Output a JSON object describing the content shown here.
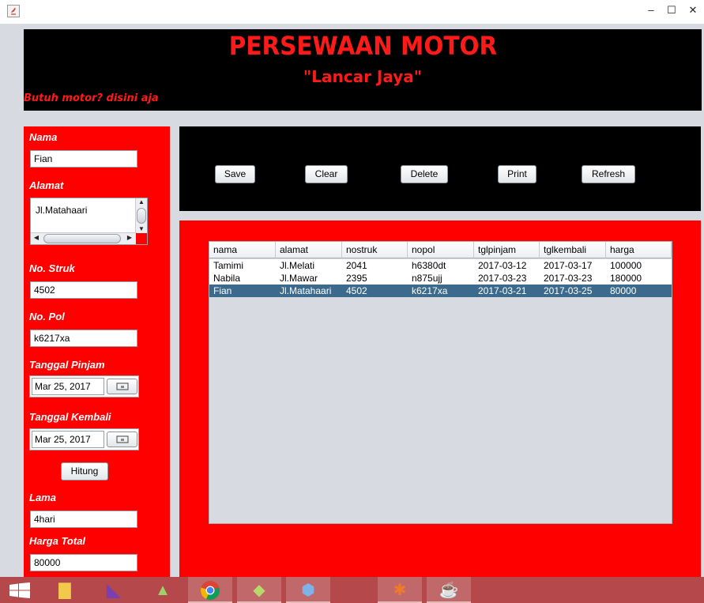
{
  "window": {
    "minimize": "–",
    "maximize": "☐",
    "close": "✕"
  },
  "banner": {
    "title": "PERSEWAAN MOTOR",
    "subtitle": "\"Lancar Jaya\"",
    "tagline": "Butuh motor? disini aja"
  },
  "form": {
    "nama_label": "Nama",
    "nama_value": "Fian",
    "alamat_label": "Alamat",
    "alamat_value": "Jl.Matahaari",
    "struk_label": "No. Struk",
    "struk_value": "4502",
    "pol_label": "No. Pol",
    "pol_value": "k6217xa",
    "pinjam_label": "Tanggal Pinjam",
    "pinjam_value": "Mar 25, 2017",
    "kembali_label": "Tanggal Kembali",
    "kembali_value": "Mar 25, 2017",
    "hitung_label": "Hitung",
    "lama_label": "Lama",
    "lama_value": "4hari",
    "harga_label": "Harga Total",
    "harga_value": "80000"
  },
  "toolbar": {
    "save": "Save",
    "clear": "Clear",
    "delete": "Delete",
    "print": "Print",
    "refresh": "Refresh"
  },
  "table": {
    "columns": [
      "nama",
      "alamat",
      "nostruk",
      "nopol",
      "tglpinjam",
      "tglkembali",
      "harga"
    ],
    "rows": [
      [
        "Tamimi",
        "Jl.Melati",
        "2041",
        "h6380dt",
        "2017-03-12",
        "2017-03-17",
        "100000"
      ],
      [
        "Nabila",
        "Jl.Mawar",
        "2395",
        "n875ujj",
        "2017-03-23",
        "2017-03-23",
        "180000"
      ],
      [
        "Fian",
        "Jl.Matahaari",
        "4502",
        "k6217xa",
        "2017-03-21",
        "2017-03-25",
        "80000"
      ]
    ],
    "selected_row": 2
  },
  "taskbar": {
    "items": [
      {
        "name": "windows-start-icon",
        "glyph": "⊞",
        "color": "#ffffff"
      },
      {
        "name": "file-explorer-icon",
        "glyph": "▇",
        "color": "#f2c94c"
      },
      {
        "name": "visual-studio-icon",
        "glyph": "◣",
        "color": "#7b3fb0"
      },
      {
        "name": "android-studio-icon",
        "glyph": "▲",
        "color": "#9bd36b"
      },
      {
        "name": "chrome-icon",
        "glyph": "◉",
        "color": "#e8b22c"
      },
      {
        "name": "sticky-app-icon",
        "glyph": "◆",
        "color": "#b8d86a"
      },
      {
        "name": "box-app-icon",
        "glyph": "⬢",
        "color": "#7fb2e6"
      },
      {
        "name": "xampp-icon",
        "glyph": "✱",
        "color": "#f07a2a"
      },
      {
        "name": "java-icon",
        "glyph": "☕",
        "color": "#e05a2a"
      }
    ]
  }
}
